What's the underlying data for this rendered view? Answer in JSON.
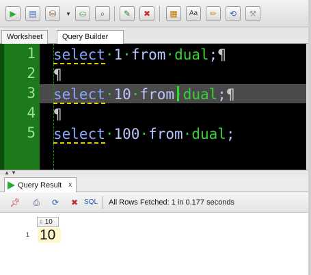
{
  "toolbar": {
    "buttons": [
      {
        "name": "run-statement-icon",
        "glyph": "▶",
        "color": "#2fa82f"
      },
      {
        "name": "run-script-icon",
        "glyph": "▤",
        "color": "#3a6fc4"
      },
      {
        "name": "commit-icon",
        "glyph": "⛁",
        "color": "#8a5a2b"
      },
      {
        "name": "rollback-icon",
        "glyph": "⛀",
        "color": "#2f8f3f"
      },
      {
        "name": "explain-plan-icon",
        "glyph": "⌕",
        "color": "#4a4a8a"
      },
      {
        "name": "autotrace-icon",
        "glyph": "✎",
        "color": "#2f7f2f"
      },
      {
        "name": "clear-icon",
        "glyph": "✖",
        "color": "#c03030"
      },
      {
        "name": "format-sql-icon",
        "glyph": "▦",
        "color": "#c27a00"
      },
      {
        "name": "case-change-icon",
        "glyph": "Aa",
        "color": "#333333"
      },
      {
        "name": "eraser-icon",
        "glyph": "✏",
        "color": "#d08a20"
      },
      {
        "name": "history-icon",
        "glyph": "⟲",
        "color": "#2a5fa8"
      },
      {
        "name": "tuning-advisor-icon",
        "glyph": "⚒",
        "color": "#9a9a9a"
      }
    ]
  },
  "tabs": [
    {
      "label": "Worksheet",
      "active": false
    },
    {
      "label": "Query Builder",
      "active": true
    }
  ],
  "editor": {
    "lines": [
      {
        "number": "1",
        "keyword": "select",
        "value": "1",
        "from_kw": "from",
        "table": "dual",
        "end": ";"
      },
      {
        "number": "2"
      },
      {
        "number": "3",
        "keyword": "select",
        "value": "10",
        "from_kw": "from",
        "table": "dual",
        "end": ";"
      },
      {
        "number": "4"
      },
      {
        "number": "5",
        "keyword": "select",
        "value": "100",
        "from_kw": "from",
        "table": "dual",
        "end": ";"
      }
    ],
    "pilcrow": "¶",
    "space_dot": "·"
  },
  "results": {
    "tab_label": "Query Result",
    "tab_close": "x",
    "sql_label": "SQL",
    "status": "All Rows Fetched: 1 in 0.177 seconds",
    "grid": {
      "columns": [
        "10"
      ],
      "rows": [
        {
          "row_number": "1",
          "cells": [
            "10"
          ]
        }
      ]
    }
  }
}
